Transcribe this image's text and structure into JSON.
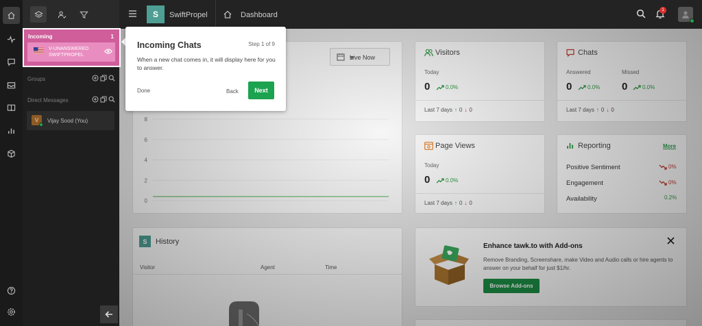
{
  "colors": {
    "accent": "#1ca34f",
    "incoming_card": "#cf5e9b",
    "logo": "#4e9e93",
    "badge": "#d9322f",
    "positive": "#2f9a46",
    "negative": "#c0392b"
  },
  "rail": {
    "icons": [
      "home-icon",
      "activity-icon",
      "chat-icon",
      "inbox-icon",
      "knowledge-base-icon",
      "reports-icon",
      "addons-icon",
      "help-icon",
      "settings-icon"
    ]
  },
  "panel": {
    "tab_icons": [
      "layers-icon",
      "user-check-icon",
      "filter-icon"
    ],
    "incoming": {
      "title": "Incoming",
      "count": "1",
      "item_line1": "V-UNANSWERED",
      "item_line2": "SWIFTPROPEL"
    },
    "groups_label": "Groups",
    "direct_messages_label": "Direct Messages",
    "contact": {
      "initial": "V",
      "name": "Vijay Sood (You)"
    }
  },
  "topbar": {
    "logo_letter": "S",
    "site_name": "SwiftPropel",
    "page_title": "Dashboard",
    "notification_count": "1"
  },
  "popover": {
    "title": "Incoming Chats",
    "step": "Step 1 of 9",
    "body": "When a new chat comes in, it will display here for you to answer.",
    "done_label": "Done",
    "back_label": "Back",
    "next_label": "Next"
  },
  "live": {
    "selected": "Live Now"
  },
  "chart_data": {
    "type": "line",
    "yticks": [
      "0",
      "2",
      "4",
      "6",
      "8"
    ],
    "ylim": [
      0,
      8
    ],
    "series": [
      {
        "values": [
          0,
          0
        ]
      }
    ]
  },
  "visitors": {
    "title": "Visitors",
    "today_label": "Today",
    "value": "0",
    "pct": "0.0%",
    "last7_label": "Last 7 days",
    "up": "0",
    "down": "0"
  },
  "chats": {
    "title": "Chats",
    "answered_label": "Answered",
    "missed_label": "Missed",
    "answered_value": "0",
    "missed_value": "0",
    "answered_pct": "0.0%",
    "missed_pct": "0.0%",
    "last7_label": "Last 7 days",
    "up": "0",
    "down": "0"
  },
  "pageviews": {
    "title": "Page Views",
    "today_label": "Today",
    "value": "0",
    "pct": "0.0%",
    "last7_label": "Last 7 days",
    "up": "0",
    "down": "0"
  },
  "reporting": {
    "title": "Reporting",
    "more_label": "More",
    "rows": [
      {
        "label": "Positive Sentiment",
        "value": "0%",
        "trend": "down"
      },
      {
        "label": "Engagement",
        "value": "0%",
        "trend": "down"
      },
      {
        "label": "Availability",
        "value": "0.2%",
        "trend": "up"
      }
    ]
  },
  "history": {
    "logo_letter": "S",
    "title": "History",
    "columns": [
      "Visitor",
      "Agent",
      "Time"
    ]
  },
  "addons": {
    "title": "Enhance tawk.to with Add-ons",
    "description": "Remove Branding, Screenshare, make Video and Audio calls or hire agents to answer on your behalf for just $1/hr.",
    "button_label": "Browse Add-ons"
  }
}
